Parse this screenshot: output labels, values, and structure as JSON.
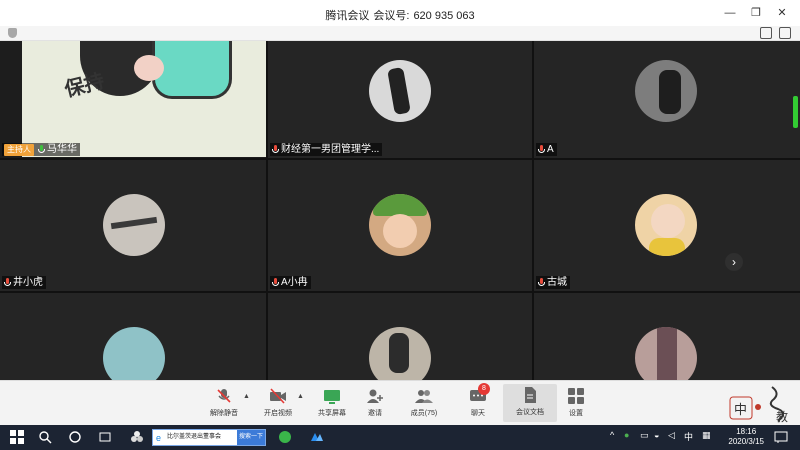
{
  "titlebar": {
    "app_name": "腾讯会议",
    "meeting_id_label": "会议号:",
    "meeting_id": "620 935 063",
    "minimize": "—",
    "restore": "❐",
    "close": "✕"
  },
  "tiles": [
    {
      "name": "马华华",
      "host_badge": "主持人",
      "mic": "ok",
      "type": "video"
    },
    {
      "name": "财经第一男团管理学...",
      "mic": "muted",
      "type": "avatar",
      "color": "#d9d9d9"
    },
    {
      "name": "A",
      "mic": "muted",
      "type": "avatar",
      "color": "#7d7d7d"
    },
    {
      "name": "井小虎",
      "mic": "muted",
      "type": "avatar",
      "color": "#c9c4bd"
    },
    {
      "name": "A小冉",
      "mic": "muted",
      "type": "avatar",
      "color": "#d3a982"
    },
    {
      "name": "古城",
      "mic": "muted",
      "type": "avatar",
      "color": "#efd3a6"
    },
    {
      "name": "",
      "mic": "",
      "type": "avatar",
      "color": "#8fc2c7"
    },
    {
      "name": "",
      "mic": "",
      "type": "avatar",
      "color": "#bdb5a8"
    },
    {
      "name": "",
      "mic": "",
      "type": "avatar",
      "color": "#b89e9a"
    }
  ],
  "main_video": {
    "text": "保持"
  },
  "next_page": "›",
  "toolbar": {
    "unmute": "解除静音",
    "start_video": "开启视频",
    "share_screen": "共享屏幕",
    "invite": "邀请",
    "members": "成员(75)",
    "chat": "聊天",
    "chat_badge": "8",
    "docs": "会议文档",
    "settings": "设置",
    "arrow": "▲"
  },
  "seal": {
    "text1": "中",
    "text2": "教"
  },
  "taskbar": {
    "ie_text": "比尔盖茨退出董事会",
    "ie_search": "搜索一下",
    "ime": "中",
    "time": "18:16",
    "date": "2020/3/15"
  }
}
